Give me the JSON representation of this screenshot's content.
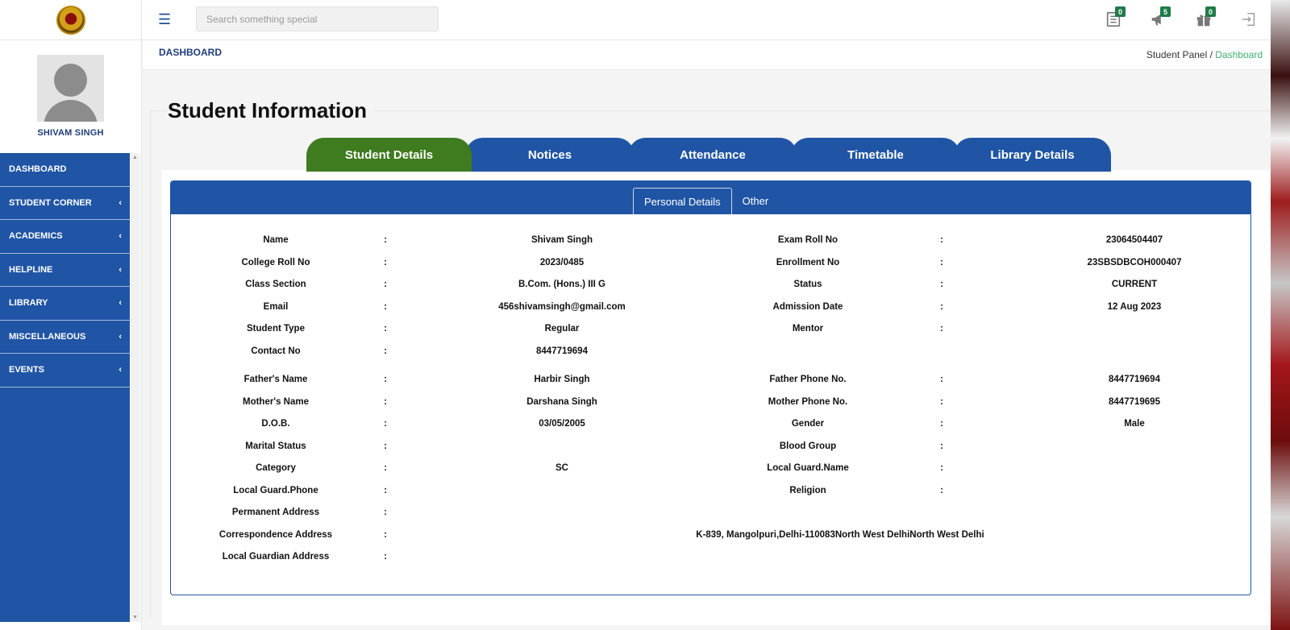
{
  "header": {
    "search_placeholder": "Search something special",
    "notifications": [
      {
        "name": "list-icon",
        "count": "0"
      },
      {
        "name": "megaphone-icon",
        "count": "5"
      },
      {
        "name": "gift-icon",
        "count": "0"
      }
    ]
  },
  "sidebar": {
    "profile_name": "SHIVAM SINGH",
    "items": [
      {
        "label": "DASHBOARD",
        "has_submenu": false
      },
      {
        "label": "STUDENT CORNER",
        "has_submenu": true
      },
      {
        "label": "ACADEMICS",
        "has_submenu": true
      },
      {
        "label": "HELPLINE",
        "has_submenu": true
      },
      {
        "label": "LIBRARY",
        "has_submenu": true
      },
      {
        "label": "MISCELLANEOUS",
        "has_submenu": true
      },
      {
        "label": "EVENTS",
        "has_submenu": true
      }
    ]
  },
  "page": {
    "title": "DASHBOARD",
    "breadcrumb": {
      "parent": "Student Panel",
      "current": "Dashboard"
    },
    "section_title": "Student Information"
  },
  "tabs": [
    "Student Details",
    "Notices",
    "Attendance",
    "Timetable",
    "Library Details"
  ],
  "sub_tabs": [
    "Personal Details",
    "Other"
  ],
  "details": [
    {
      "l1": "Name",
      "v1": "Shivam Singh",
      "l2": "Exam Roll No",
      "v2": "23064504407"
    },
    {
      "l1": "College Roll No",
      "v1": "2023/0485",
      "l2": "Enrollment No",
      "v2": "23SBSDBCOH000407"
    },
    {
      "l1": "Class Section",
      "v1": "B.Com. (Hons.) III G",
      "l2": "Status",
      "v2": "CURRENT"
    },
    {
      "l1": "Email",
      "v1": "456shivamsingh@gmail.com",
      "l2": "Admission Date",
      "v2": "12 Aug 2023"
    },
    {
      "l1": "Student Type",
      "v1": "Regular",
      "l2": "Mentor",
      "v2": ""
    },
    {
      "l1": "Contact No",
      "v1": "8447719694",
      "l2": "",
      "v2": ""
    },
    {
      "l1": "Father's Name",
      "v1": "Harbir Singh",
      "l2": "Father Phone No.",
      "v2": "8447719694"
    },
    {
      "l1": "Mother's Name",
      "v1": "Darshana Singh",
      "l2": "Mother Phone No.",
      "v2": "8447719695"
    },
    {
      "l1": "D.O.B.",
      "v1": "03/05/2005",
      "l2": "Gender",
      "v2": "Male"
    },
    {
      "l1": "Marital Status",
      "v1": "",
      "l2": "Blood Group",
      "v2": ""
    },
    {
      "l1": "Category",
      "v1": "SC",
      "l2": "Local Guard.Name",
      "v2": ""
    },
    {
      "l1": "Local Guard.Phone",
      "v1": "",
      "l2": "Religion",
      "v2": ""
    }
  ],
  "addresses": [
    {
      "label": "Permanent Address",
      "value": ""
    },
    {
      "label": "Correspondence Address",
      "value": "K-839, Mangolpuri,Delhi-110083North West DelhiNorth West Delhi"
    },
    {
      "label": "Local Guardian Address",
      "value": ""
    }
  ],
  "separator": ":",
  "colors": {
    "primary": "#2055a5",
    "active_tab": "#3f7b1f",
    "breadcrumb_active": "#3fae6f"
  }
}
